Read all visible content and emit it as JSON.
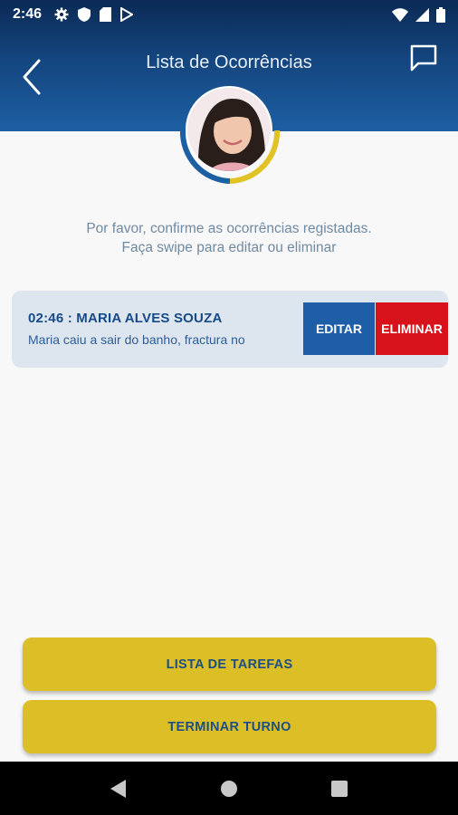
{
  "status_bar": {
    "time": "2:46",
    "left_icons": [
      "gear-icon",
      "shield-icon",
      "sim-card-icon",
      "play-store-icon"
    ],
    "right_icons": [
      "wifi-icon",
      "cellular-signal-icon",
      "battery-icon"
    ]
  },
  "header": {
    "title": "Lista de Ocorrências",
    "back_icon": "chevron-left-icon",
    "chat_icon": "chat-bubble-icon"
  },
  "profile": {
    "avatar": "user-avatar",
    "ring_colors": {
      "primary": "#1d5fa3",
      "secondary": "#e1c325"
    }
  },
  "instructions": {
    "line1": "Por favor, confirme as ocorrências registadas.",
    "line2": "Faça swipe para editar ou eliminar"
  },
  "occurrences": [
    {
      "header": "02:46 : MARIA ALVES SOUZA",
      "description": "Maria caiu a sair do banho, fractura no",
      "edit_label": "EDITAR",
      "delete_label": "ELIMINAR"
    }
  ],
  "buttons": {
    "tasks_label": "LISTA DE TAREFAS",
    "end_shift_label": "TERMINAR TURNO"
  },
  "nav": {
    "back": "nav-back-icon",
    "home": "nav-home-icon",
    "recents": "nav-recents-icon"
  },
  "colors": {
    "header_top": "#0b2a55",
    "header_bottom": "#1d5fa3",
    "accent_yellow": "#dcbe27",
    "edit_blue": "#1e5ea6",
    "delete_red": "#d8121a",
    "text_blue": "#174a88"
  }
}
